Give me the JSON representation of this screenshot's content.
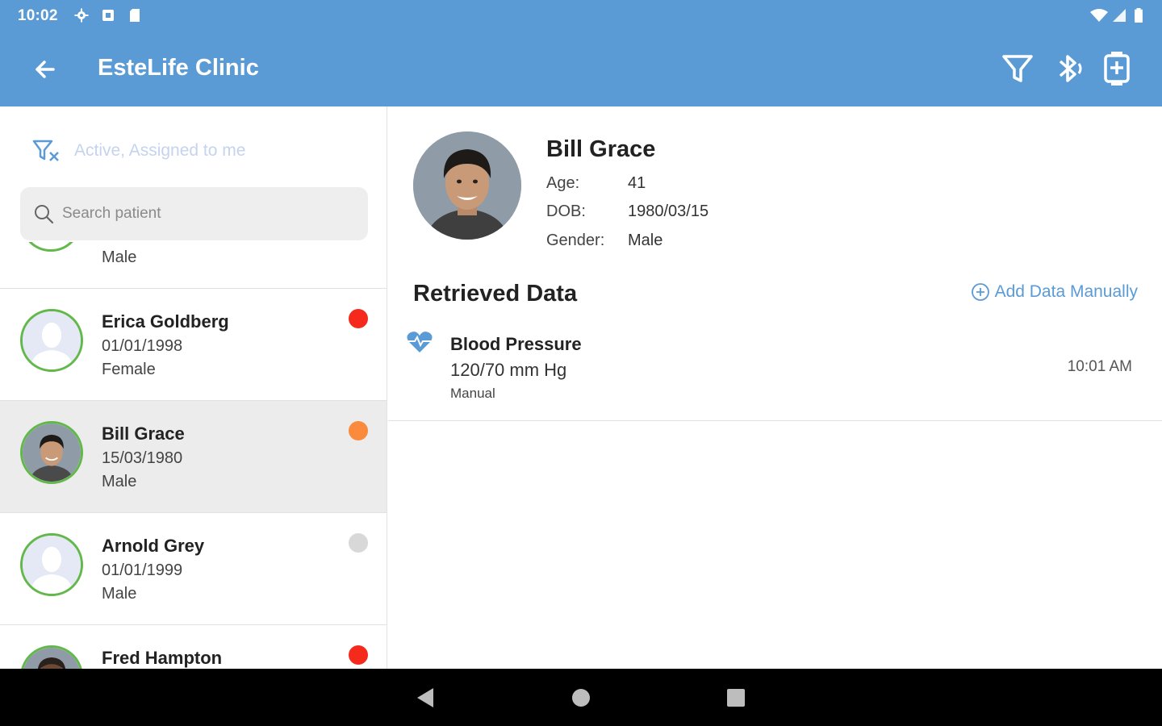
{
  "status": {
    "time": "10:02"
  },
  "appbar": {
    "title": "EsteLife Clinic"
  },
  "filter": {
    "text": "Active, Assigned to me"
  },
  "search": {
    "placeholder": "Search patient"
  },
  "list": {
    "partial_gender": "Male",
    "patients": [
      {
        "name": "Erica Goldberg",
        "dob": "01/01/1998",
        "gender": "Female",
        "status_color": "#f52a1d"
      },
      {
        "name": "Bill Grace",
        "dob": "15/03/1980",
        "gender": "Male",
        "status_color": "#fa8a3c"
      },
      {
        "name": "Arnold Grey",
        "dob": "01/01/1999",
        "gender": "Male",
        "status_color": "#d8d8d8"
      },
      {
        "name": "Fred Hampton",
        "dob": "",
        "gender": "",
        "status_color": "#f52a1d"
      }
    ]
  },
  "detail": {
    "name": "Bill Grace",
    "age_label": "Age:",
    "age": "41",
    "dob_label": "DOB:",
    "dob": "1980/03/15",
    "gender_label": "Gender:",
    "gender": "Male"
  },
  "retrieved": {
    "title": "Retrieved Data",
    "add_label": "Add Data Manually",
    "items": [
      {
        "name": "Blood Pressure",
        "value": "120/70 mm Hg",
        "source": "Manual",
        "time": "10:01 AM"
      }
    ]
  },
  "colors": {
    "primary": "#5b9bd5",
    "avatar_ring": "#62b94a"
  }
}
